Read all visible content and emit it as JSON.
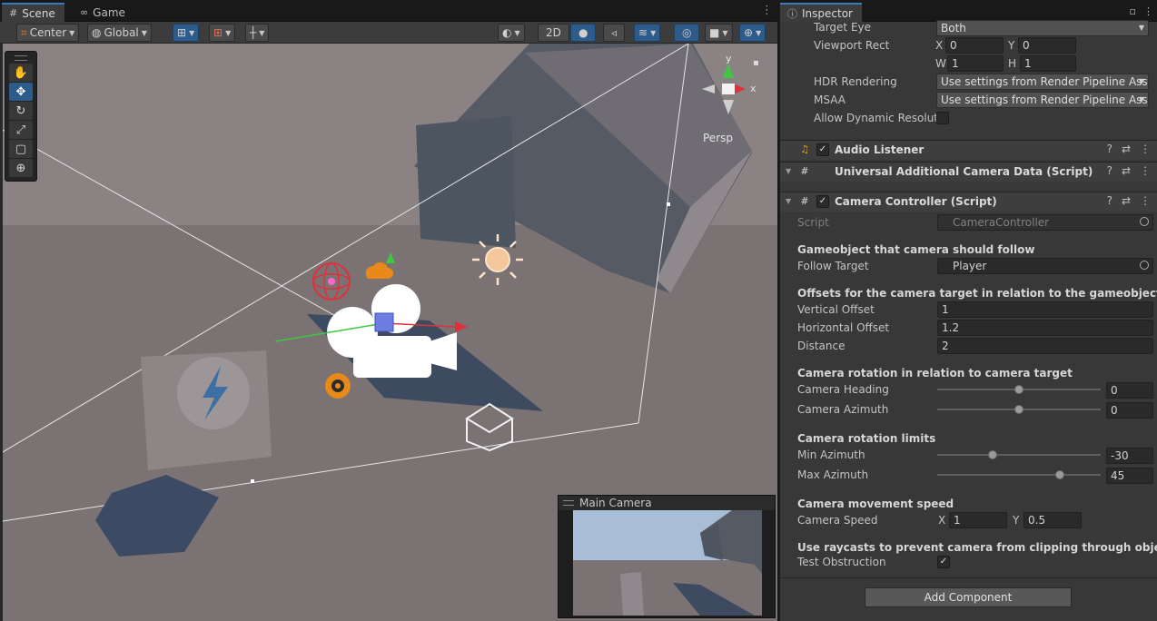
{
  "scene_window": {
    "tabs": [
      {
        "label": "Scene",
        "icon": "grid-icon"
      },
      {
        "label": "Game",
        "icon": "gamepad-icon"
      }
    ],
    "toolbar": {
      "pivot_label": "Center",
      "space_label": "Global",
      "view_2d_label": "2D"
    },
    "tools": [
      "hand-tool",
      "move-tool",
      "rotate-tool",
      "scale-tool",
      "rect-tool",
      "transform-tool"
    ],
    "active_tool": "move-tool",
    "gizmo_view_label": "Persp",
    "gizmo_axes": {
      "x": "x",
      "y": "y"
    },
    "camera_preview": {
      "title": "Main Camera"
    },
    "colors": {
      "viewport_ground": "#7b7373",
      "sky": "#a8bdd6",
      "selection_blue": "#2d5b8a"
    }
  },
  "inspector": {
    "tab_label": "Inspector",
    "camera_settings": {
      "target_eye": {
        "label": "Target Eye",
        "value": "Both"
      },
      "viewport_rect": {
        "label": "Viewport Rect",
        "x_label": "X",
        "x": "0",
        "y_label": "Y",
        "y": "0",
        "w_label": "W",
        "w": "1",
        "h_label": "H",
        "h": "1"
      },
      "hdr_rendering": {
        "label": "HDR Rendering",
        "value": "Use settings from Render Pipeline Asse"
      },
      "msaa": {
        "label": "MSAA",
        "value": "Use settings from Render Pipeline Asse"
      },
      "allow_dynamic": {
        "label": "Allow Dynamic Resoluti",
        "checked": false
      }
    },
    "components": {
      "audio_listener": {
        "title": "Audio Listener",
        "enabled": true
      },
      "universal_data": {
        "title": "Universal Additional Camera Data (Script)"
      },
      "camera_controller": {
        "title": "Camera Controller (Script)",
        "enabled": true
      }
    },
    "camera_controller": {
      "script": {
        "label": "Script",
        "value": "CameraController"
      },
      "section_follow": "Gameobject that camera should follow",
      "follow_target": {
        "label": "Follow Target",
        "value": "Player"
      },
      "section_offsets": "Offsets for the camera target in relation to the gameobject",
      "vertical_offset": {
        "label": "Vertical Offset",
        "value": "1"
      },
      "horizontal_offset": {
        "label": "Horizontal Offset",
        "value": "1.2"
      },
      "distance": {
        "label": "Distance",
        "value": "2"
      },
      "section_rotation": "Camera rotation in relation to camera target",
      "camera_heading": {
        "label": "Camera Heading",
        "value": "0",
        "fraction": 0.5
      },
      "camera_azimuth": {
        "label": "Camera Azimuth",
        "value": "0",
        "fraction": 0.5
      },
      "section_limits": "Camera rotation limits",
      "min_azimuth": {
        "label": "Min Azimuth",
        "value": "-30",
        "fraction": 0.34
      },
      "max_azimuth": {
        "label": "Max Azimuth",
        "value": "45",
        "fraction": 0.75
      },
      "section_speed": "Camera movement speed",
      "camera_speed": {
        "label": "Camera Speed",
        "x_label": "X",
        "x": "1",
        "y_label": "Y",
        "y": "0.5"
      },
      "section_raycast": "Use raycasts to prevent camera from clipping through objects",
      "test_obstruction": {
        "label": "Test Obstruction",
        "checked": true
      }
    },
    "add_component_label": "Add Component"
  }
}
